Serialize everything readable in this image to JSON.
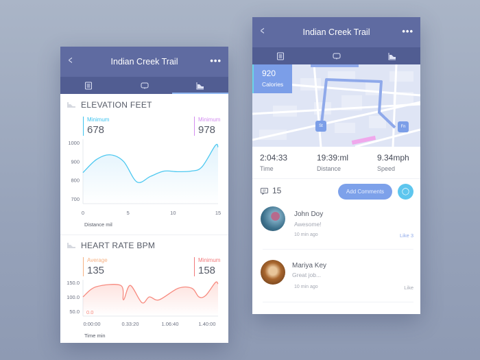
{
  "title": "Indian Creek Trail",
  "colors": {
    "header": "#5f6ba1",
    "tabbar": "#515d92",
    "elevation": "#4cc8f0",
    "heart": "#f78a7f",
    "accent": "#7da1ea"
  },
  "left": {
    "elevation": {
      "title": "ELEVATION FEET",
      "stat1": {
        "label": "Minimum",
        "value": "678",
        "color": "#3cc3ef"
      },
      "stat2": {
        "label": "Minimum",
        "value": "978",
        "color": "#d38df0"
      }
    },
    "heart": {
      "title": "HEART RATE BPM",
      "stat1": {
        "label": "Average",
        "value": "135",
        "color": "#f6b183"
      },
      "stat2": {
        "label": "Minimum",
        "value": "158",
        "color": "#f2787a"
      },
      "zero_label": "0.0"
    }
  },
  "chart_data": [
    {
      "type": "area",
      "x": [
        0,
        1.5,
        3,
        4.5,
        6,
        7.5,
        9,
        10.5,
        12,
        13.2,
        14.7,
        15
      ],
      "y": [
        840,
        910,
        935,
        900,
        790,
        820,
        848,
        845,
        848,
        870,
        985,
        975
      ],
      "xlabel": "Distance mil",
      "ylabel": "",
      "xlim": [
        0,
        15
      ],
      "ylim": [
        700,
        1000
      ],
      "xticks": [
        "0",
        "5",
        "10",
        "15"
      ],
      "yticks": [
        "1000",
        "900",
        "800",
        "700"
      ]
    },
    {
      "type": "area",
      "x": [
        0,
        580,
        1675,
        1800,
        2100,
        2620,
        2950,
        3380,
        4230,
        4840,
        5150,
        5450,
        5880,
        6000
      ],
      "y": [
        100,
        135,
        140,
        90,
        140,
        80,
        100,
        90,
        130,
        130,
        100,
        105,
        150,
        145
      ],
      "xlabel": "Time min",
      "ylabel": "",
      "xlim": [
        0,
        6000
      ],
      "ylim": [
        0,
        150
      ],
      "xticks": [
        "0:00:00",
        "0.33:20",
        "1.06:40",
        "1.40:00"
      ],
      "yticks": [
        "150.0",
        "100.0",
        "50.0"
      ]
    }
  ],
  "right": {
    "calories": {
      "value": "920",
      "label": "Calories"
    },
    "map": {
      "start": "St",
      "finish": "Fn"
    },
    "metrics": [
      {
        "value": "2:04:33",
        "label": "Time"
      },
      {
        "value": "19:39:ml",
        "label": "Distance"
      },
      {
        "value": "9.34mph",
        "label": "Speed"
      }
    ],
    "comment_count": "15",
    "add_comments": "Add Comments",
    "comments": [
      {
        "name": "John Doy",
        "text": "Awesome!",
        "time": "10 min ago",
        "like": "Like  3"
      },
      {
        "name": "Mariya Key",
        "text": "Great job...",
        "time": "10 min ago",
        "like": "Like"
      }
    ]
  }
}
